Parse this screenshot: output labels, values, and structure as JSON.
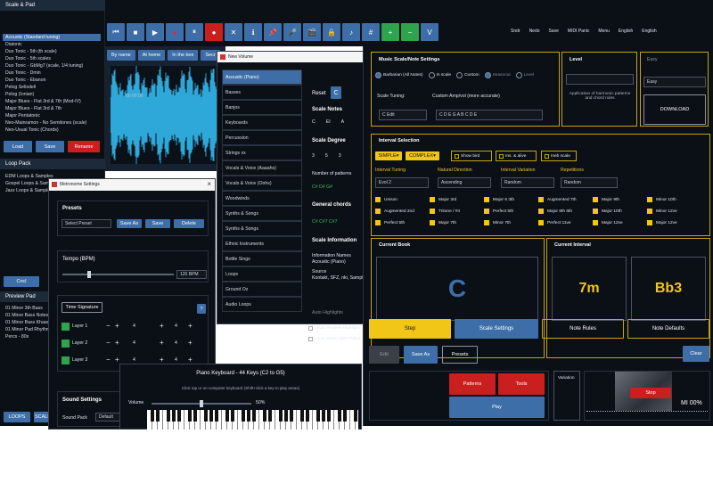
{
  "left_sidebar": {
    "title": "Scale & Pad",
    "scales": [
      "Acoustic (Standard tuning)",
      "Diatonic",
      "Duo Tonic - 5th (th scale)",
      "Duo Tonic - 5th scales",
      "Duo Tonic - GbMg7 (scale, 1/4 tuning)",
      "Duo Tonic - Dmin",
      "Duo Tonic - Ebanon",
      "Pelog Selisdell",
      "Pelog (Ionian)",
      "Major Blues - Flat 3rd & 7th (Mod-IV)",
      "Major Blues - Flat 3rd & 7th",
      "Major Pentatonic",
      "Neo-Mainramon - No Semitones (scale)",
      "Neo-Usual Tonic (Chords)"
    ],
    "load": "Load",
    "save": "Save",
    "rename": "Rename",
    "loop_pack_title": "Loop Pack",
    "loops": [
      "EDM Loops & Samples",
      "Gospel Loops & Samples",
      "Jazz Loops & Samples"
    ],
    "cancel": "Cncl",
    "preview_pad_title": "Preview Pad",
    "pads": [
      "01 Minor 3th Bass",
      "01 Minor Bass Notes",
      "01 Minor Bass Khases",
      "01 Minor Pad Rhythms",
      "Percs - 80s"
    ],
    "loops_btn": "LOOPS",
    "scale_btn": "SCALE"
  },
  "toolbar": {
    "icons": [
      "skip-back-icon",
      "stop-icon",
      "play-icon",
      "record-icon",
      "pause-icon",
      "record-active-icon",
      "close-icon",
      "info-icon",
      "pin-icon",
      "mic-icon",
      "video-icon",
      "lock-icon",
      "note-icon",
      "sharp-icon",
      "add-icon",
      "minus-icon",
      "v-icon"
    ],
    "glyphs": [
      "⏮",
      "■",
      "▶",
      "●",
      "⏸",
      "●",
      "✕",
      "ℹ",
      "📌",
      "🎤",
      "🎬",
      "🔒",
      "♪",
      "#",
      "+",
      "−",
      "V"
    ],
    "right_items": [
      "Sndr",
      "Nedo",
      "Save",
      "MIDI Panic",
      "Menu",
      "English",
      "English"
    ]
  },
  "waveform_window": {
    "tabs": [
      "By name",
      "At home",
      "In the box",
      "Secr"
    ],
    "time": "00:00:00"
  },
  "volume_window": {
    "title": "New Volume",
    "items": [
      "Acoustic (Piano)",
      "Basses",
      "Banjos",
      "Keyboards",
      "Percussion",
      "Strings xx",
      "Vocals & Voice (Aaaahs)",
      "Vocals & Voice (Oohs)",
      "Woodwinds",
      "Synths & Songs",
      "Synths & Songs",
      "Ethnic Instruments",
      "Bottle Sings",
      "Loops",
      "Ground Oz",
      "Audio Loops"
    ],
    "reset": "Reset",
    "key": "C",
    "scale_notes_title": "Scale Notes",
    "scale_notes": [
      "C",
      "EI",
      "A"
    ],
    "scale_degree_title": "Scale Degree",
    "scale_degrees": [
      "3",
      "5",
      "3"
    ],
    "patterns_title": "Number of patterns",
    "patterns": "C# D# G#",
    "general_chords_title": "General chords",
    "general_chords": "C# C#7 C#7",
    "scale_info_title": "Scale Information",
    "info_names_label": "Information Names",
    "info_names_value": "Acoustic (Piano)",
    "source_label": "Source",
    "source_value": "Kontakt, SFZ, nki, Sample",
    "auto_highlights": "Auto Highlights",
    "auto_preview": "Auto Preview Highlight",
    "auto_select": "Auto Select Next Patch"
  },
  "metronome": {
    "title": "Metronome Settings",
    "presets_title": "Presets",
    "preset_placeholder": "Select Preset",
    "save_as": "Save As",
    "save": "Save",
    "delete": "Delete",
    "tempo_title": "Tempo (BPM)",
    "tempo_value": "120 BPM",
    "time_sig_title": "Time Signature",
    "help": "?",
    "layers": [
      {
        "label": "Layer 1",
        "a": "4",
        "b": "4"
      },
      {
        "label": "Layer 2",
        "a": "4",
        "b": "4"
      },
      {
        "label": "Layer 3",
        "a": "4",
        "b": "4"
      }
    ],
    "sound_title": "Sound Settings",
    "sound_pack": "Sound Pack",
    "sound_value": "Default"
  },
  "piano": {
    "title": "Piano Keyboard - 44 Keys (C2 to G5)",
    "subtitle": "Click top or on computer keyboard (Shift+click a key to play areas)",
    "volume_label": "Volume",
    "volume_value": "50%",
    "volume_level": 0.5
  },
  "main": {
    "scale_settings_title": "Music Scale/Note Settings",
    "radios": [
      "Barbarian (All Notes)",
      "In scale",
      "Custom",
      "Seasonal",
      "Level"
    ],
    "scale_tuning_label": "Scale Tuning:",
    "scale_tuning_value": "Custom Amp/vol (more accurate)",
    "tuning_field": "C Edit",
    "tuning_notes": "C D E G A  B C D E",
    "level_title": "Level",
    "level_placeholder": "",
    "level_text": "Application of harmonic patterns and chord rules",
    "easy_label": "Easy",
    "easy_value": "Easy",
    "download": "DOWNLOAD",
    "interval_title": "Interval Selection",
    "simple": "SIMPLE",
    "complex": "COMPLEX",
    "show_bird": "Show bird",
    "ins_alive": "Ins. & alive",
    "ineb_scale": "Ineb scale",
    "col_headers": [
      "Interval Tuning",
      "Natural Direction",
      "Interval Variation",
      "Repetitions"
    ],
    "col_values": [
      "Evol 2",
      "Ascending",
      "Random",
      "Random"
    ],
    "intervals": [
      [
        "Unison",
        "Major 3rd",
        "Major 6 3th",
        "Augmented 7th",
        "Major 9th",
        "Minor 10th"
      ],
      [
        "Augmented 2nd",
        "Tritone / #4",
        "Perfect 5th",
        "Major 6th 6th",
        "Major 10th",
        "Minor 12ve"
      ],
      [
        "Perfect 5th",
        "Major 7th",
        "Minor 7th",
        "Perfect 11ve",
        "Major 12ve",
        "Major 12ve"
      ]
    ],
    "current_book_title": "Current Book",
    "current_book_value": "C",
    "current_interval_title": "Current Interval",
    "interval_a": "7m",
    "interval_b": "Bb3",
    "step": "Step",
    "scale_settings_btn": "Scale Settings",
    "note_rules": "Note Rules",
    "note_defaults": "Note Defaults",
    "edit": "Edit",
    "save_as": "Save As",
    "presets": "Presets",
    "clear": "Clear",
    "patterns": "Patterns",
    "tools": "Tools",
    "play": "Play",
    "variation": "Variation",
    "stop": "Stop",
    "status": "MI 00%"
  }
}
